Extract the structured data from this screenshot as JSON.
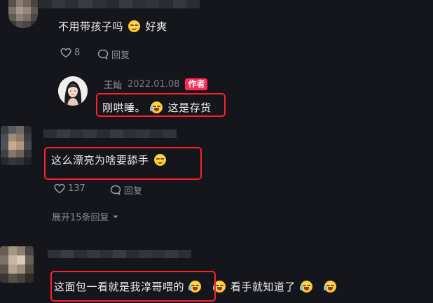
{
  "comments": [
    {
      "text": "不用带孩子吗",
      "emoji_after": "smirk-emoji",
      "text_after_emoji": "好爽",
      "likes": "8",
      "reply_label": "回复"
    },
    {
      "text": "这么漂亮为啥要舔手",
      "emoji_after": "smirk-emoji",
      "likes": "137",
      "reply_label": "回复",
      "expand_label": "展开15条回复"
    },
    {
      "text": "这面包一看就是我淳哥喂的",
      "emojis_after": [
        "laugh-emoji",
        "laugh-emoji"
      ],
      "text_after_emojis": "看手就知道了",
      "emojis_end": [
        "laugh-emoji",
        "laugh-emoji"
      ]
    }
  ],
  "reply": {
    "username": "王灿",
    "date": "2022.01.08",
    "badge": "作者",
    "text": "刚哄睡。",
    "emoji_after": "laugh-emoji",
    "text_after_emoji": "这是存货"
  },
  "colors": {
    "background": "#15161c",
    "highlight_box": "#ff1f2a",
    "author_badge": "#fe2c55",
    "meta_text": "#8b8d94"
  }
}
